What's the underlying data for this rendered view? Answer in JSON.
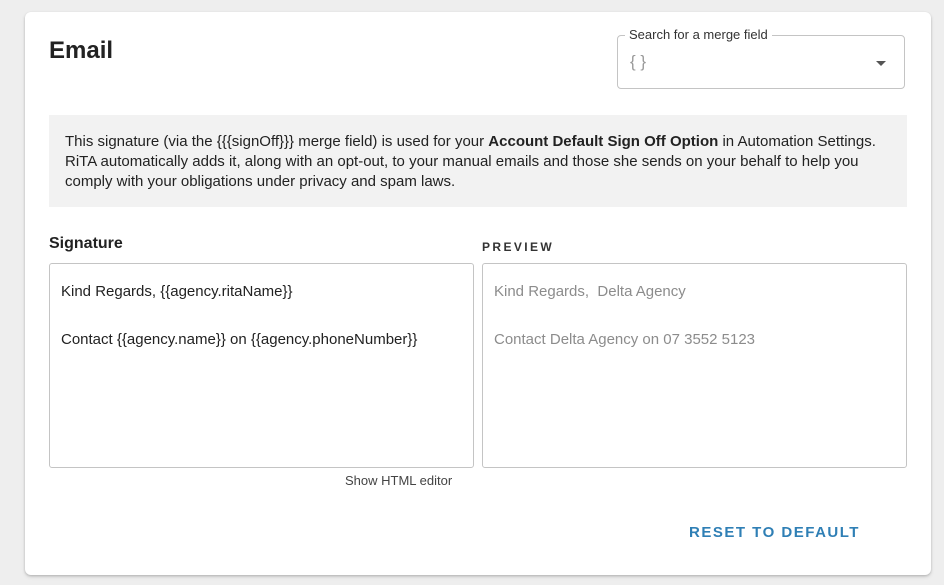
{
  "header": {
    "title": "Email"
  },
  "merge_search": {
    "label": "Search for a merge field",
    "placeholder": "{ }"
  },
  "info": {
    "text_before": "This signature (via the {{{signOff}}} merge field) is used for your ",
    "bold_text": "Account Default Sign Off Option",
    "text_after": " in Automation Settings. RiTA automatically adds it, along with an opt-out, to your manual emails and those she sends on your behalf to help you comply with your obligations under privacy and spam laws."
  },
  "signature": {
    "label": "Signature",
    "lines": [
      "Kind Regards, {{agency.ritaName}}",
      "Contact {{agency.name}} on {{agency.phoneNumber}}"
    ],
    "show_html_label": "Show HTML editor"
  },
  "preview": {
    "label": "PREVIEW",
    "lines": [
      "Kind Regards,  Delta Agency",
      "Contact Delta Agency on 07 3552 5123"
    ]
  },
  "actions": {
    "reset_label": "RESET TO DEFAULT"
  },
  "colors": {
    "accent": "#2f7fb5",
    "info_background": "#f2f2f2",
    "border": "#c4c4c4"
  }
}
